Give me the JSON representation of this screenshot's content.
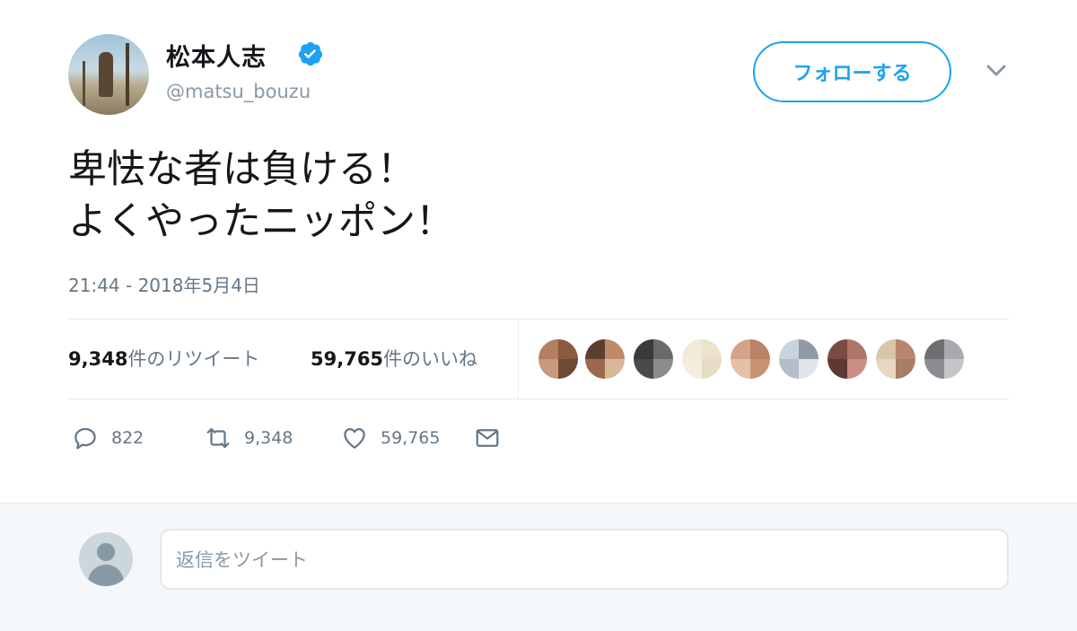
{
  "author": {
    "display_name": "松本人志",
    "handle": "@matsu_bouzu",
    "verified": true
  },
  "follow_button_label": "フォローする",
  "tweet": {
    "lines": [
      "卑怯な者は負ける！",
      "よくやったニッポン！"
    ],
    "timestamp": "21:44 - 2018年5月4日"
  },
  "stats": {
    "retweets_count": "9,348",
    "retweets_suffix": "件のリツイート",
    "likes_count": "59,765",
    "likes_suffix": "件のいいね"
  },
  "actions": {
    "reply_count": "822",
    "retweet_count": "9,348",
    "like_count": "59,765"
  },
  "reply": {
    "placeholder": "返信をツイート"
  },
  "colors": {
    "accent": "#1da1f2",
    "muted": "#657786",
    "text": "#14171a"
  },
  "icons": [
    "verified-badge-icon",
    "chevron-down-icon",
    "reply-icon",
    "retweet-icon",
    "like-icon",
    "direct-message-icon"
  ]
}
